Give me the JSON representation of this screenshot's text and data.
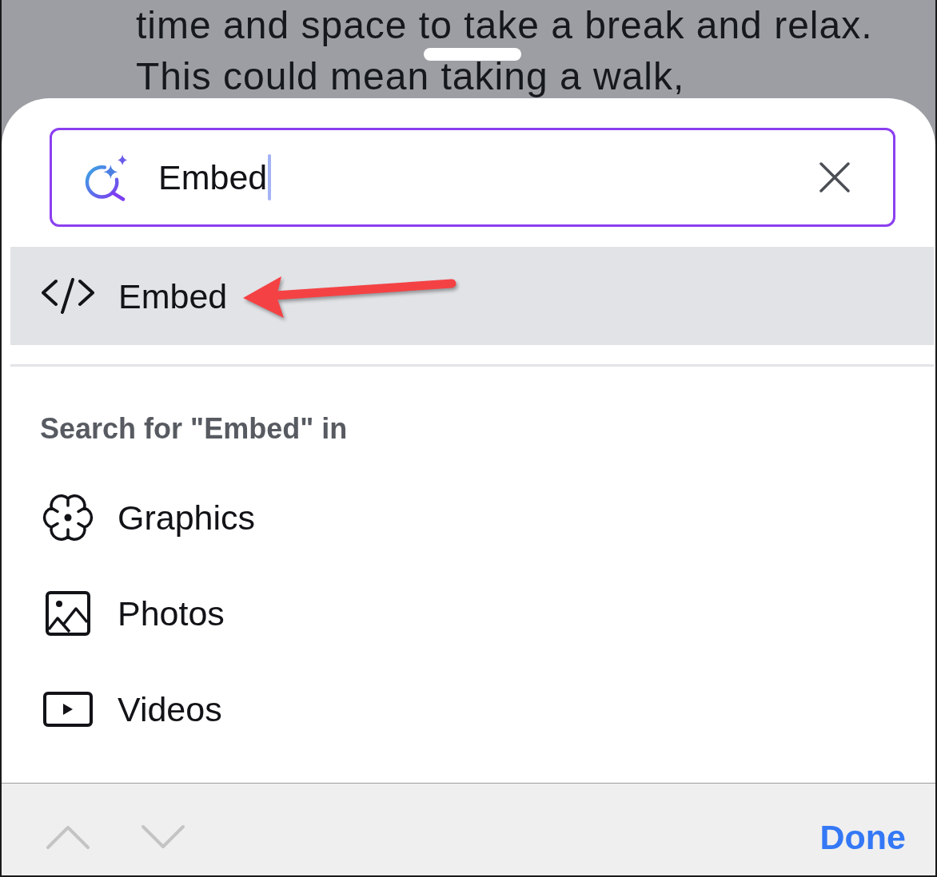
{
  "document_text": {
    "lines": [
      "time and space to take a break and relax.",
      "This could mean taking a walk,"
    ]
  },
  "sheet": {
    "search": {
      "value": "Embed",
      "focused": true
    },
    "results": [
      {
        "kind": "embed",
        "label": "Embed",
        "selected": true
      }
    ],
    "section_title": "Search for \"Embed\" in",
    "categories": [
      {
        "kind": "graphics",
        "label": "Graphics"
      },
      {
        "kind": "photos",
        "label": "Photos"
      },
      {
        "kind": "videos",
        "label": "Videos"
      }
    ]
  },
  "toolbar": {
    "nav": [
      {
        "kind": "previous",
        "disabled": true
      },
      {
        "kind": "next",
        "disabled": true
      }
    ],
    "done": "Done"
  }
}
